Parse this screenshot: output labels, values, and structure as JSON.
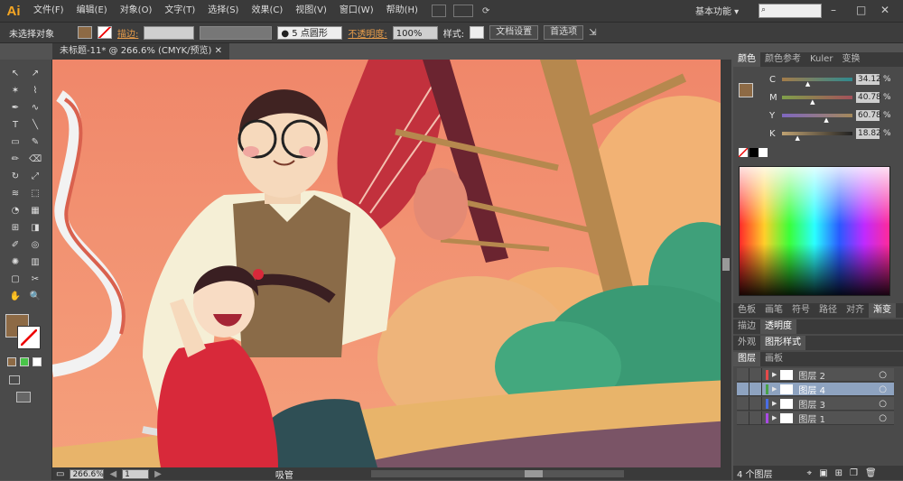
{
  "app": {
    "logo": "Ai"
  },
  "menu": [
    "文件(F)",
    "编辑(E)",
    "对象(O)",
    "文字(T)",
    "选择(S)",
    "效果(C)",
    "视图(V)",
    "窗口(W)",
    "帮助(H)"
  ],
  "workspace": "基本功能",
  "control": {
    "selection": "未选择对象",
    "stroke_label": "描边:",
    "brush": "5 点圆形",
    "opacity_label": "不透明度:",
    "opacity_value": "100%",
    "style_label": "样式:",
    "doc_setup": "文档设置",
    "prefs": "首选项"
  },
  "document": {
    "tab": "未标题-11* @ 266.6% (CMYK/预览)"
  },
  "status": {
    "zoom": "266.6%",
    "page": "1",
    "tool": "吸管"
  },
  "color_panel": {
    "tabs": [
      "颜色",
      "颜色参考",
      "Kuler",
      "变换"
    ],
    "channels": [
      {
        "name": "C",
        "value": "34.12",
        "pos": 0.34,
        "track": "linear-gradient(to right,#a37c4a,#2f8a8f)"
      },
      {
        "name": "M",
        "value": "40.78",
        "pos": 0.41,
        "track": "linear-gradient(to right,#7f9f4a,#a4505a)"
      },
      {
        "name": "Y",
        "value": "60.78",
        "pos": 0.61,
        "track": "linear-gradient(to right,#7f67c0,#a3885a)"
      },
      {
        "name": "K",
        "value": "18.82",
        "pos": 0.19,
        "track": "linear-gradient(to right,#bfa272,#222)"
      }
    ],
    "fill_color": "#8d6a45"
  },
  "panel_tabs_2": [
    "色板",
    "画笔",
    "符号",
    "路径",
    "对齐",
    "渐变"
  ],
  "panel_tabs_3": [
    "描边",
    "透明度"
  ],
  "panel_tabs_4": [
    "外观",
    "图形样式"
  ],
  "layers_panel": {
    "tabs": [
      "图层",
      "画板"
    ],
    "layers": [
      {
        "name": "图层 2",
        "selected": false,
        "color": "#e54a4a"
      },
      {
        "name": "图层 4",
        "selected": true,
        "color": "#49a249"
      },
      {
        "name": "图层 3",
        "selected": false,
        "color": "#4a6de5"
      },
      {
        "name": "图层 1",
        "selected": false,
        "color": "#a94ae5"
      }
    ],
    "count": "4 个图层"
  }
}
